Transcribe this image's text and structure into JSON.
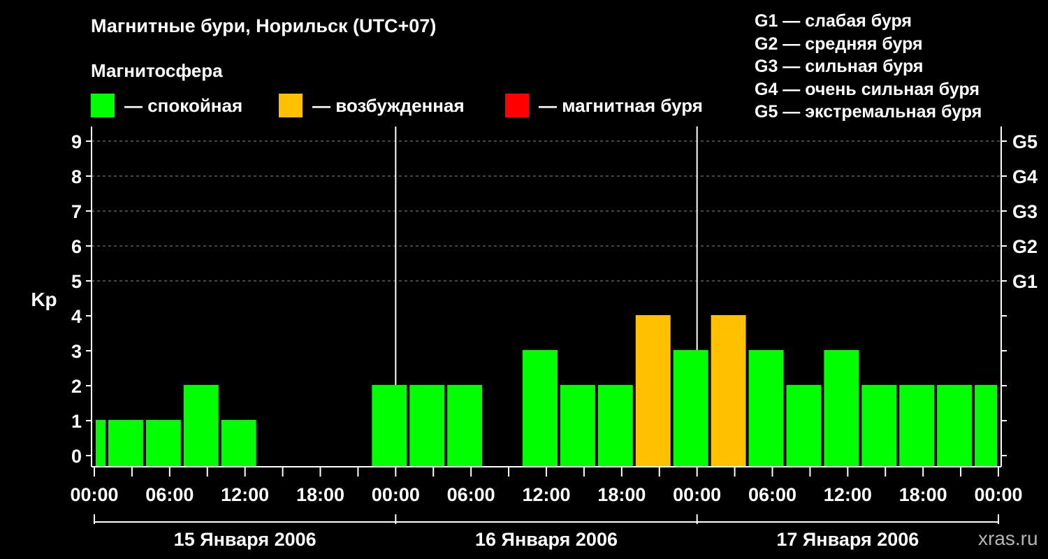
{
  "title": "Магнитные бури, Норильск (UTC+07)",
  "magnetosphere_label": "Магнитосфера",
  "legend": [
    {
      "label": "— спокойная",
      "color": "#00ff00"
    },
    {
      "label": "— возбужденная",
      "color": "#ffc000"
    },
    {
      "label": "— магнитная буря",
      "color": "#ff0000"
    }
  ],
  "g_scale": [
    "G1 — слабая буря",
    "G2 — средняя буря",
    "G3 — сильная буря",
    "G4 — очень сильная буря",
    "G5 — экстремальная буря"
  ],
  "watermark": "xras.ru",
  "chart_data": {
    "type": "bar",
    "ylabel": "Kp",
    "ylim": [
      0,
      9
    ],
    "yticks": [
      "0",
      "1",
      "2",
      "3",
      "4",
      "5",
      "6",
      "7",
      "8",
      "9"
    ],
    "right_labels": [
      {
        "kp": 5,
        "label": "G1"
      },
      {
        "kp": 6,
        "label": "G2"
      },
      {
        "kp": 7,
        "label": "G3"
      },
      {
        "kp": 8,
        "label": "G4"
      },
      {
        "kp": 9,
        "label": "G5"
      }
    ],
    "x_range_hours": [
      0,
      72
    ],
    "xtick_labels": [
      "00:00",
      "06:00",
      "12:00",
      "18:00",
      "00:00",
      "06:00",
      "12:00",
      "18:00",
      "00:00",
      "06:00",
      "12:00",
      "18:00",
      "00:00"
    ],
    "xtick_hours": [
      0,
      6,
      12,
      18,
      24,
      30,
      36,
      42,
      48,
      54,
      60,
      66,
      72
    ],
    "days": [
      "15 Января 2006",
      "16 Января 2006",
      "17 Января 2006"
    ],
    "bar_width_hours": 3,
    "series": [
      {
        "start_hours": [
          0,
          1,
          4,
          7,
          10,
          22,
          25,
          28,
          34,
          37,
          40,
          43,
          46,
          49,
          52,
          55,
          58,
          61,
          64,
          67,
          70
        ],
        "end_hours": [
          1,
          4,
          7,
          10,
          13,
          25,
          28,
          31,
          37,
          40,
          43,
          46,
          49,
          52,
          55,
          58,
          61,
          64,
          67,
          70,
          72
        ],
        "kp": [
          1,
          1,
          1,
          2,
          1,
          2,
          2,
          2,
          3,
          2,
          2,
          4,
          3,
          4,
          3,
          2,
          3,
          2,
          2,
          2,
          2
        ],
        "status": [
          "quiet",
          "quiet",
          "quiet",
          "quiet",
          "quiet",
          "quiet",
          "quiet",
          "quiet",
          "quiet",
          "quiet",
          "quiet",
          "excited",
          "quiet",
          "excited",
          "quiet",
          "quiet",
          "quiet",
          "quiet",
          "quiet",
          "quiet",
          "quiet"
        ]
      }
    ],
    "status_colors": {
      "quiet": "#00ff00",
      "excited": "#ffc000",
      "storm": "#ff0000"
    }
  }
}
